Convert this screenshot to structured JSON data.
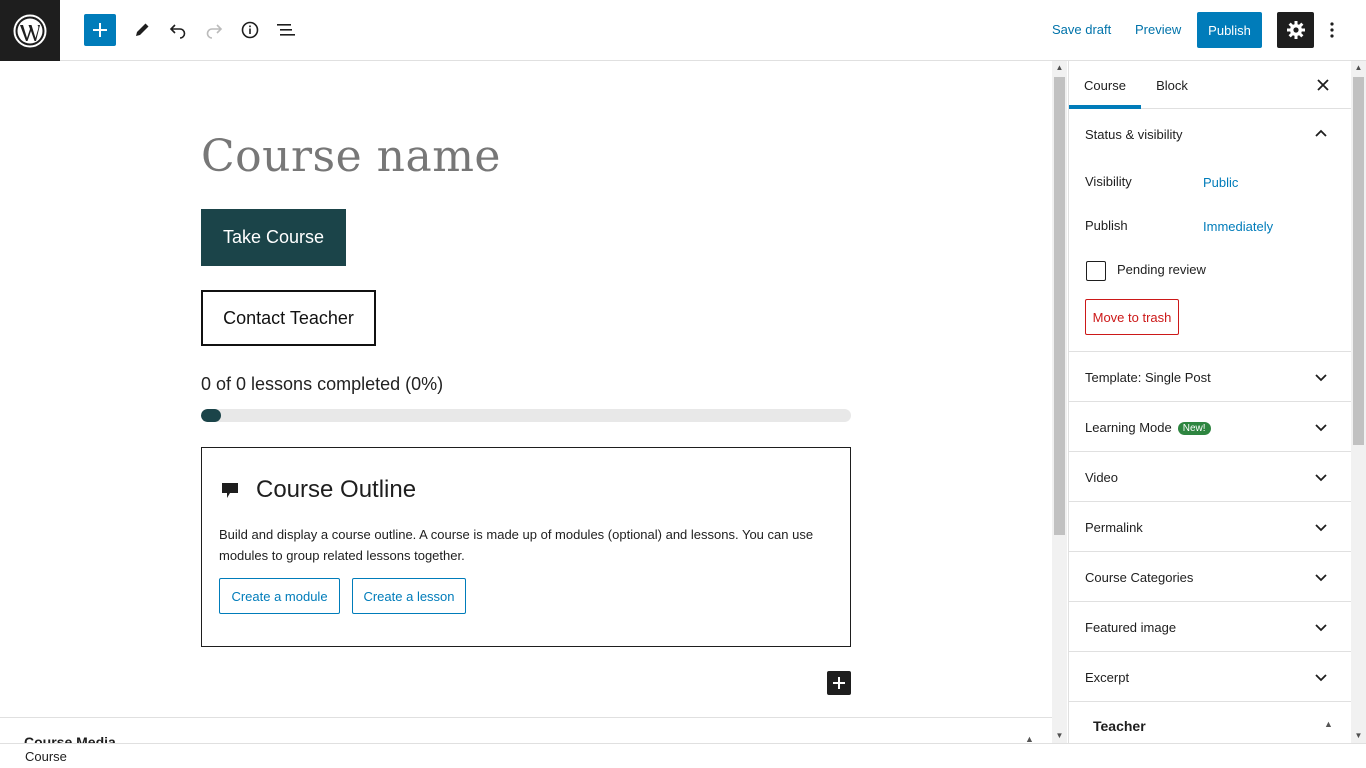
{
  "topbar": {
    "save_draft": "Save draft",
    "preview": "Preview",
    "publish": "Publish",
    "icons": [
      "wordpress-logo",
      "plus-icon",
      "pencil-icon",
      "undo-icon",
      "redo-icon",
      "info-icon",
      "list-view-icon",
      "gear-icon",
      "more-vertical-icon"
    ]
  },
  "editor": {
    "title_placeholder": "Course name",
    "take_course": "Take Course",
    "contact_teacher": "Contact Teacher",
    "progress_text": "0 of 0 lessons completed (0%)",
    "progress_indicator_fraction": 0.03,
    "outline": {
      "title": "Course Outline",
      "description": "Build and display a course outline. A course is made up of modules (optional) and lessons. You can use modules to group related lessons together.",
      "create_module": "Create a module",
      "create_lesson": "Create a lesson"
    },
    "metabox_title": "Course Media"
  },
  "footer": {
    "breadcrumb": "Course"
  },
  "sidebar": {
    "tabs": [
      "Course",
      "Block"
    ],
    "active_tab": "Course",
    "status": {
      "title": "Status & visibility",
      "visibility_label": "Visibility",
      "visibility_value": "Public",
      "publish_label": "Publish",
      "publish_value": "Immediately",
      "pending_review": "Pending review",
      "move_to_trash": "Move to trash"
    },
    "panels": [
      {
        "label": "Template: Single Post"
      },
      {
        "label": "Learning Mode",
        "badge": "New!"
      },
      {
        "label": "Video"
      },
      {
        "label": "Permalink"
      },
      {
        "label": "Course Categories"
      },
      {
        "label": "Featured image"
      },
      {
        "label": "Excerpt"
      }
    ],
    "teacher_title": "Teacher"
  },
  "colors": {
    "accent": "#007cba",
    "dark_button": "#1b4449",
    "destructive": "#cc1818",
    "badge": "#2e8540"
  }
}
